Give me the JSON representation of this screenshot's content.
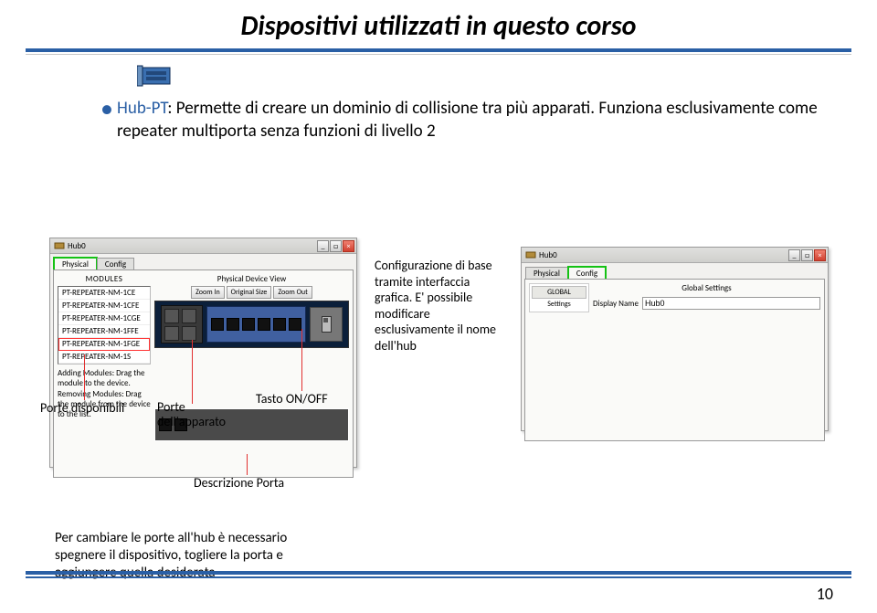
{
  "title": "Dispositivi utilizzati in questo corso",
  "bullet1": {
    "prefix": "Hub-PT",
    "text": ": Permette di creare un dominio di collisione tra più apparati. Funziona esclusivamente come repeater multiporta senza funzioni di livello 2"
  },
  "winLeft": {
    "title": "Hub0",
    "tabs": [
      "Physical",
      "Config"
    ],
    "modulesTitle": "MODULES",
    "modules": [
      "PT-REPEATER-NM-1CE",
      "PT-REPEATER-NM-1CFE",
      "PT-REPEATER-NM-1CGE",
      "PT-REPEATER-NM-1FFE",
      "PT-REPEATER-NM-1FGE",
      "PT-REPEATER-NM-1S"
    ],
    "helpText": "Adding Modules: Drag the module to the device. Removing Modules: Drag the module from the device to the list.",
    "physTitle": "Physical Device View",
    "zoom": [
      "Zoom In",
      "Original Size",
      "Zoom Out"
    ]
  },
  "winRight": {
    "title": "Hub0",
    "tabs": [
      "Physical",
      "Config"
    ],
    "side": [
      "GLOBAL",
      "Settings"
    ],
    "panelTitle": "Global Settings",
    "fieldLabel": "Display Name",
    "fieldValue": "Hub0"
  },
  "labels": {
    "porteDisponibili": "Porte disponibili",
    "porteApparato": "Porte dell'apparato",
    "tastoOnOff": "Tasto ON/OFF",
    "descrizionePorta": "Descrizione Porta",
    "configurazione": "Configurazione di base tramite interfaccia grafica. E' possibile modificare esclusivamente il nome dell'hub"
  },
  "footnote": "Per cambiare le porte all'hub è necessario spegnere il dispositivo, togliere la porta e aggiungere quella desiderata",
  "pageNumber": "10"
}
